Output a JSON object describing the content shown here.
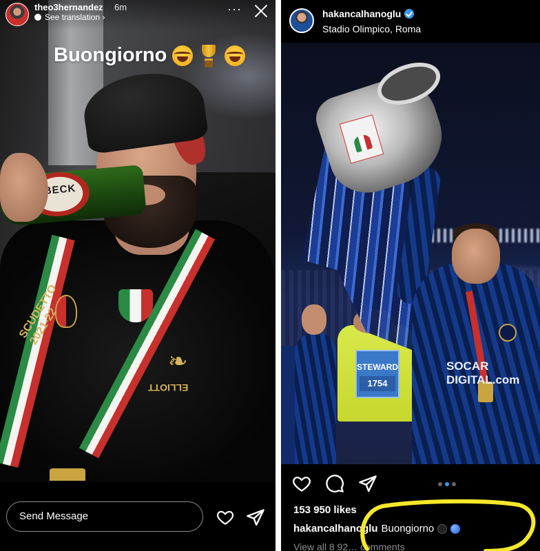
{
  "story": {
    "username": "theo3hernandez",
    "time": "6m",
    "see_translation": "See translation ›",
    "more": "···",
    "caption": "Buongiorno",
    "bottle_brand": "BECK",
    "shirt_text_left": "SCUDETTO 2021-22",
    "shirt_text_right": "ELLIOTT",
    "send_placeholder": "Send Message"
  },
  "post": {
    "username": "hakancalhanoglu",
    "location": "Stadio Olimpico, Roma",
    "sponsor": "SOCAR DIGITAL.com",
    "steward_label": "STEWARD",
    "steward_number": "1754",
    "likes": "153 950 likes",
    "caption_user": "hakancalhanoglu",
    "caption_text": "Buongiorno",
    "comments": "View all 8 92… comments",
    "pager": [
      false,
      true,
      false
    ]
  },
  "colors": {
    "story_bg": "#0a0a0a",
    "post_bg": "#000000",
    "verified": "#3897f0",
    "highlight": "#f5e82a",
    "italy_green": "#2b8a45",
    "italy_red": "#c8302d",
    "inter_blue": "#143a8a"
  },
  "icons": [
    "close-icon",
    "more-icon",
    "heart-icon",
    "send-icon",
    "comment-icon",
    "verified-icon",
    "translate-icon"
  ]
}
